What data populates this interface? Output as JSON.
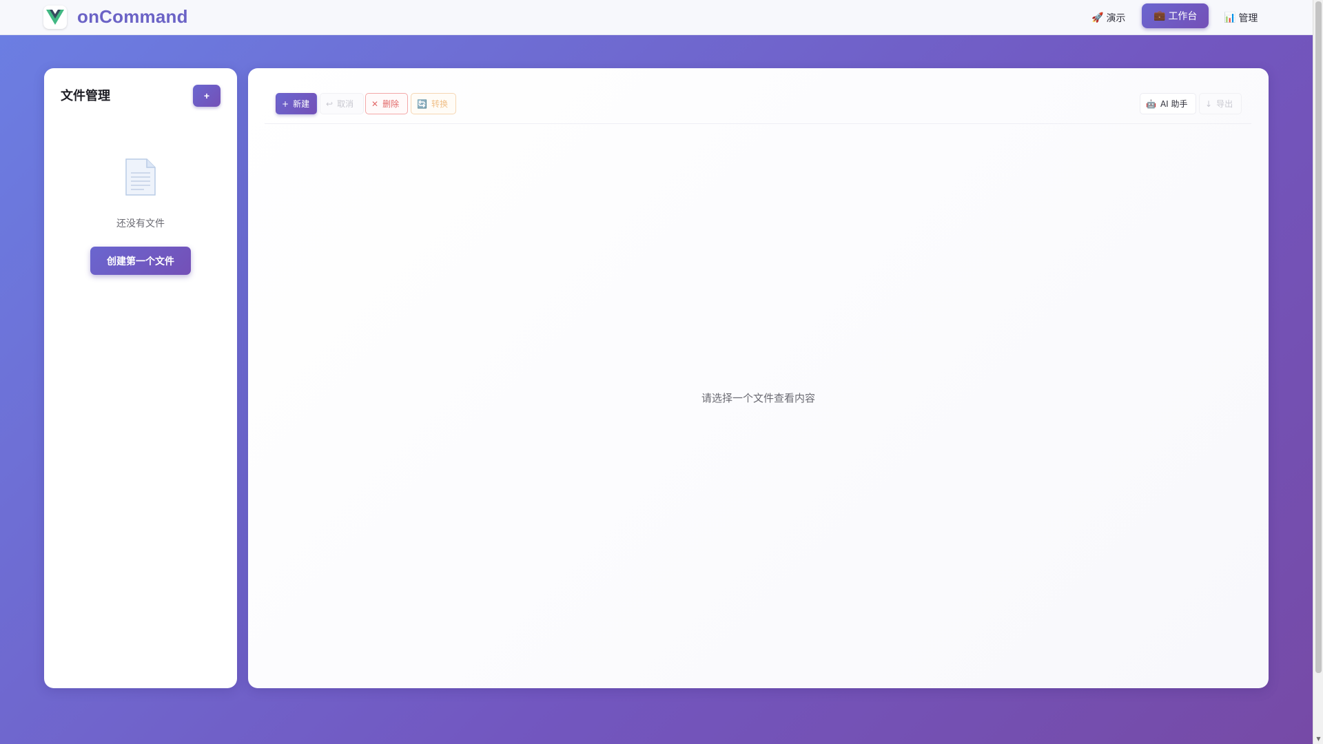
{
  "app": {
    "brand": "onCommand"
  },
  "nav": {
    "items": [
      {
        "label": "演示",
        "icon": "rocket-icon",
        "glyph": "🚀"
      },
      {
        "label": "工作台",
        "icon": "briefcase-icon",
        "glyph": "💼",
        "active": true
      },
      {
        "label": "管理",
        "icon": "bar-chart-icon",
        "glyph": "📊"
      }
    ]
  },
  "sidebar": {
    "title": "文件管理",
    "add_label": "+",
    "empty_text": "还没有文件",
    "create_first_label": "创建第一个文件"
  },
  "toolbar": {
    "new": {
      "glyph": "+",
      "label": "新建"
    },
    "cancel": {
      "glyph": "↩",
      "label": "取消"
    },
    "delete": {
      "glyph": "✕",
      "label": "删除"
    },
    "convert": {
      "glyph": "🔄",
      "label": "转换"
    },
    "ai": {
      "glyph": "🤖",
      "label": "AI 助手"
    },
    "export": {
      "glyph": "↓",
      "label": "导出"
    }
  },
  "main": {
    "placeholder": "请选择一个文件查看内容"
  },
  "colors": {
    "accent": "#6b63c6",
    "background_start": "#6b7fe3",
    "background_end": "#764aa6",
    "danger": "#e26a6a",
    "warning": "#f0c08a"
  }
}
